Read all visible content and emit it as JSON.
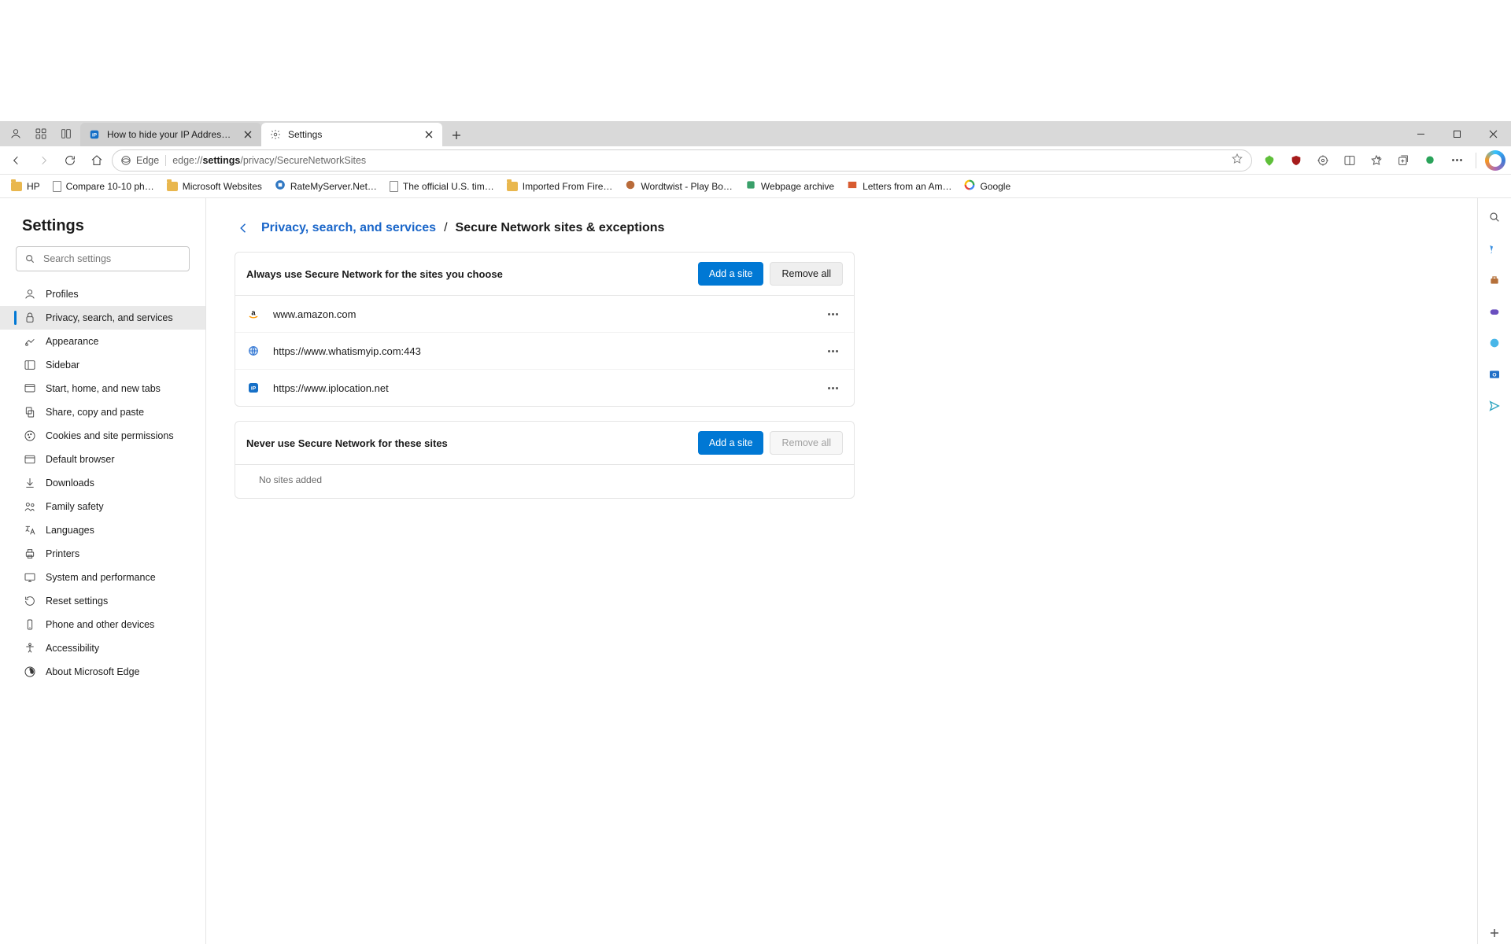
{
  "window": {
    "tabs": [
      {
        "title": "How to hide your IP Address wit…",
        "favicon": "ip-icon",
        "active": false
      },
      {
        "title": "Settings",
        "favicon": "gear-icon",
        "active": true
      }
    ]
  },
  "address": {
    "chip_label": "Edge",
    "url_prefix": "edge://",
    "url_bold": "settings",
    "url_suffix": "/privacy/SecureNetworkSites"
  },
  "bookmarks": [
    {
      "label": "HP",
      "kind": "folder"
    },
    {
      "label": "Compare 10-10 ph…",
      "kind": "page"
    },
    {
      "label": "Microsoft Websites",
      "kind": "folder"
    },
    {
      "label": "RateMyServer.Net…",
      "kind": "fav-rms"
    },
    {
      "label": "The official U.S. tim…",
      "kind": "page"
    },
    {
      "label": "Imported From Fire…",
      "kind": "folder"
    },
    {
      "label": "Wordtwist - Play Bo…",
      "kind": "fav-wt"
    },
    {
      "label": "Webpage archive",
      "kind": "fav-arch"
    },
    {
      "label": "Letters from an Am…",
      "kind": "fav-news"
    },
    {
      "label": "Google",
      "kind": "fav-google"
    }
  ],
  "settings": {
    "title": "Settings",
    "search_placeholder": "Search settings",
    "nav": [
      "Profiles",
      "Privacy, search, and services",
      "Appearance",
      "Sidebar",
      "Start, home, and new tabs",
      "Share, copy and paste",
      "Cookies and site permissions",
      "Default browser",
      "Downloads",
      "Family safety",
      "Languages",
      "Printers",
      "System and performance",
      "Reset settings",
      "Phone and other devices",
      "Accessibility",
      "About Microsoft Edge"
    ],
    "active_index": 1
  },
  "breadcrumb": {
    "parent": "Privacy, search, and services",
    "separator": "/",
    "current": "Secure Network sites & exceptions"
  },
  "cards": {
    "always": {
      "title": "Always use Secure Network for the sites you choose",
      "add_label": "Add a site",
      "remove_label": "Remove all",
      "sites": [
        {
          "url": "www.amazon.com",
          "icon": "amazon"
        },
        {
          "url": "https://www.whatismyip.com:443",
          "icon": "globe"
        },
        {
          "url": "https://www.iplocation.net",
          "icon": "ip"
        }
      ]
    },
    "never": {
      "title": "Never use Secure Network for these sites",
      "add_label": "Add a site",
      "remove_label": "Remove all",
      "empty_text": "No sites added"
    }
  }
}
